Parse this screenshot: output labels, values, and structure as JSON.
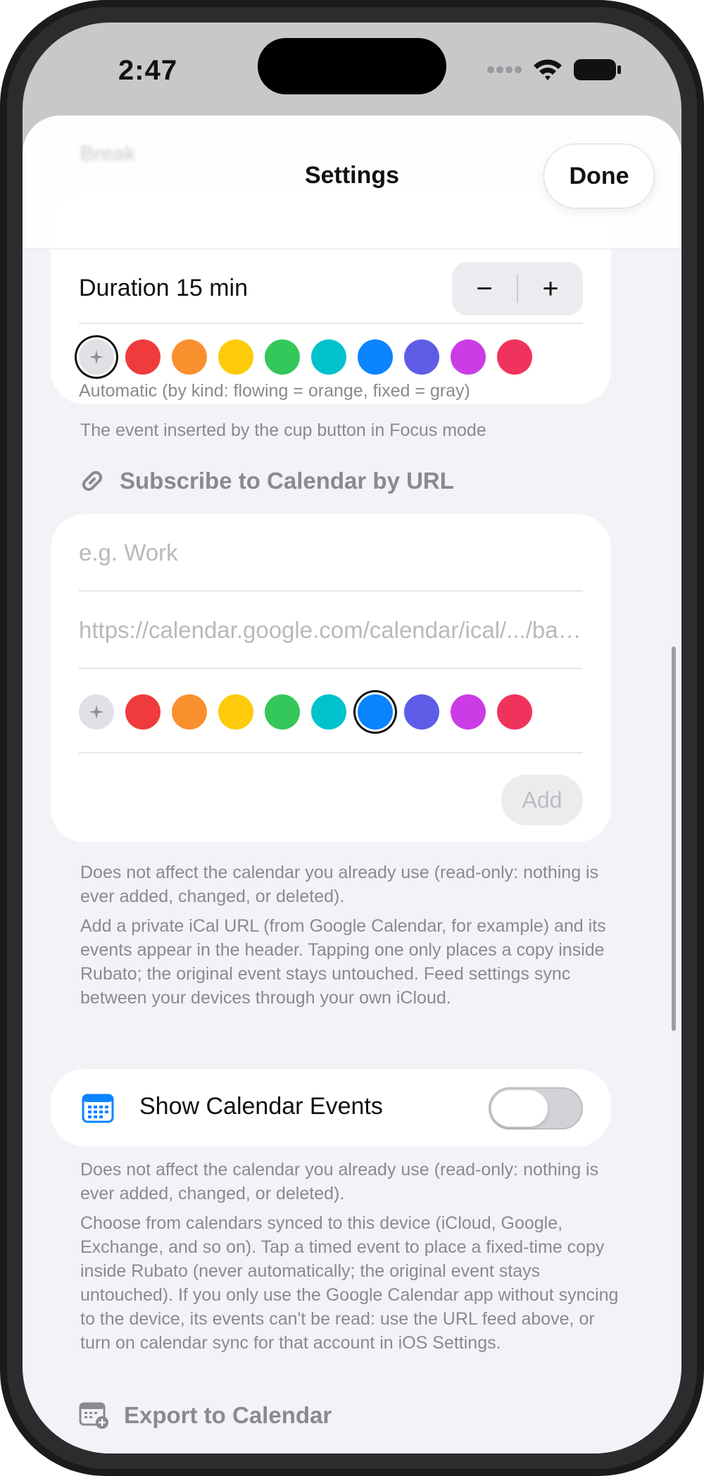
{
  "status_bar": {
    "time": "2:47"
  },
  "nav": {
    "ghost_title": "Break",
    "title": "Settings",
    "done_label": "Done"
  },
  "focus_break": {
    "duration_label": "Duration 15 min",
    "minus_label": "−",
    "plus_label": "+",
    "color_caption": "Automatic (by kind: flowing = orange, fixed = gray)",
    "footer": "The event inserted by the cup button in Focus mode"
  },
  "palette": [
    "#ef3b3b",
    "#fa8f2e",
    "#fecb0a",
    "#34c759",
    "#00c2cc",
    "#0a84ff",
    "#5e5ce6",
    "#cc3ce6",
    "#f0335d"
  ],
  "palette_selected": {
    "focus": "auto",
    "subscribe": "#0a84ff"
  },
  "subscribe": {
    "header": "Subscribe to Calendar by URL",
    "name_placeholder": "e.g. Work",
    "url_placeholder": "https://calendar.google.com/calendar/ical/.../basic.ics",
    "add_label": "Add",
    "footer_1": "Does not affect the calendar you already use (read-only: nothing is ever added, changed, or deleted).",
    "footer_2": "Add a private iCal URL (from Google Calendar, for example) and its events appear in the header. Tapping one only places a copy inside Rubato; the original event stays untouched. Feed settings sync between your devices through your own iCloud."
  },
  "calendar_events": {
    "label": "Show Calendar Events",
    "enabled": false,
    "footer_1": "Does not affect the calendar you already use (read-only: nothing is ever added, changed, or deleted).",
    "footer_2": "Choose from calendars synced to this device (iCloud, Google, Exchange, and so on). Tap a timed event to place a fixed-time copy inside Rubato (never automatically; the original event stays untouched). If you only use the Google Calendar app without syncing to the device, its events can't be read: use the URL feed above, or turn on calendar sync for that account in iOS Settings."
  },
  "export": {
    "header": "Export to Calendar"
  },
  "colors": {
    "accent": "#0a84ff",
    "background": "#f2f2f7",
    "secondary_text": "#8a8a8e"
  }
}
